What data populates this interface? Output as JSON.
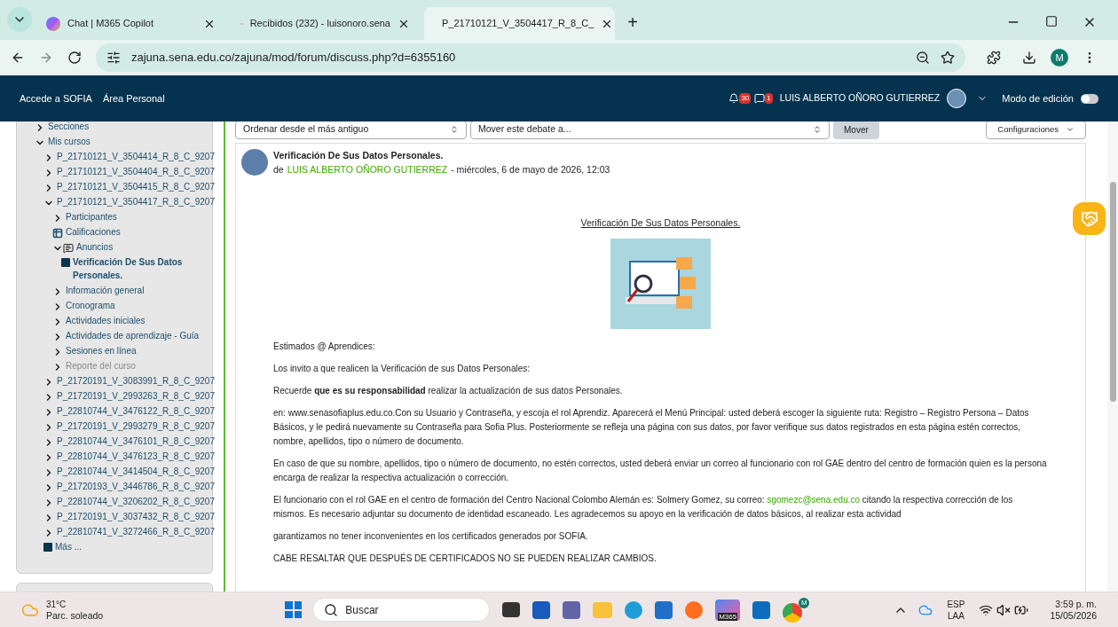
{
  "browser": {
    "tabs": [
      {
        "title": "Chat | M365 Copilot",
        "kind": "copilot",
        "selected": false
      },
      {
        "title": "Recibidos (232) - luisonoro.sena",
        "kind": "gmail",
        "selected": false
      },
      {
        "title": "P_21710121_V_3504417_R_8_C_",
        "kind": "sena",
        "selected": true
      }
    ],
    "new_tab": "+",
    "url": "zajuna.sena.edu.co/zajuna/mod/forum/discuss.php?d=6355160",
    "profile": "M"
  },
  "navbar": {
    "links": [
      "Accede a SOFIA",
      "Área Personal"
    ],
    "notifications": "30",
    "messages": "1",
    "user": "LUIS ALBERTO OÑORO GUTIERREZ",
    "edit_mode": {
      "label": "Modo de edición",
      "on": false
    }
  },
  "sidebar": {
    "items": [
      {
        "label": "Secciones",
        "kind": "node",
        "expanded": false
      },
      {
        "label": "Mis cursos",
        "kind": "node",
        "expanded": true,
        "children": [
          {
            "label": "P_21710121_V_3504414_R_8_C_9207",
            "kind": "node",
            "expanded": false
          },
          {
            "label": "P_21710121_V_3504404_R_8_C_9207",
            "kind": "node",
            "expanded": false
          },
          {
            "label": "P_21710121_V_3504415_R_8_C_9207",
            "kind": "node",
            "expanded": false
          },
          {
            "label": "P_21710121_V_3504417_R_8_C_9207",
            "kind": "node",
            "expanded": true,
            "children": [
              {
                "label": "Participantes",
                "kind": "node",
                "expanded": false
              },
              {
                "label": "Calificaciones",
                "kind": "grades"
              },
              {
                "label": "Anuncios",
                "kind": "forum",
                "expanded": true,
                "children": [
                  {
                    "label": "Verificación De Sus Datos Personales.",
                    "kind": "page",
                    "selected": true
                  }
                ]
              },
              {
                "label": "Información general",
                "kind": "node",
                "expanded": false
              },
              {
                "label": "Cronograma",
                "kind": "node",
                "expanded": false
              },
              {
                "label": "Actividades iniciales",
                "kind": "node",
                "expanded": false
              },
              {
                "label": "Actividades de aprendizaje - Guía",
                "kind": "node",
                "expanded": false
              },
              {
                "label": "Sesiones en línea",
                "kind": "node",
                "expanded": false
              },
              {
                "label": "Reporte del curso",
                "kind": "node",
                "expanded": false,
                "disabled": true
              }
            ]
          },
          {
            "label": "P_21720191_V_3083991_R_8_C_9207",
            "kind": "node",
            "expanded": false
          },
          {
            "label": "P_21720191_V_2993263_R_8_C_9207",
            "kind": "node",
            "expanded": false
          },
          {
            "label": "P_22810744_V_3476122_R_8_C_9207",
            "kind": "node",
            "expanded": false
          },
          {
            "label": "P_21720191_V_2993279_R_8_C_9207",
            "kind": "node",
            "expanded": false
          },
          {
            "label": "P_22810744_V_3476101_R_8_C_9207",
            "kind": "node",
            "expanded": false
          },
          {
            "label": "P_22810744_V_3476123_R_8_C_9207",
            "kind": "node",
            "expanded": false
          },
          {
            "label": "P_22810744_V_3414504_R_8_C_9207",
            "kind": "node",
            "expanded": false
          },
          {
            "label": "P_21720193_V_3446786_R_8_C_9207",
            "kind": "node",
            "expanded": false
          },
          {
            "label": "P_22810744_V_3206202_R_8_C_9207",
            "kind": "node",
            "expanded": false
          },
          {
            "label": "P_21720191_V_3037432_R_8_C_9207",
            "kind": "node",
            "expanded": false
          },
          {
            "label": "P_22810741_V_3272466_R_8_C_9207",
            "kind": "node",
            "expanded": false
          },
          {
            "label": "Más ...",
            "kind": "page",
            "selected": false
          }
        ]
      }
    ]
  },
  "toolbar": {
    "sort": "Ordenar desde el más antiguo",
    "move": "Mover este debate a...",
    "move_button": "Mover",
    "settings": "Configuraciones"
  },
  "post": {
    "subject": "Verificación De Sus Datos Personales.",
    "by": "de",
    "author": "LUIS ALBERTO OÑORO GUTIERREZ",
    "date": "- miércoles, 6 de mayo de 2026, 12:03",
    "heading": "Verificación De Sus Datos Personales.",
    "paragraphs": [
      {
        "text": "Estimados @ Aprendices:"
      },
      {
        "text": "Los invito a que realicen la Verificación de sus Datos Personales:"
      },
      {
        "text": "Recuerde **que es su responsabilidad** realizar la actualización de sus datos Personales."
      },
      {
        "text": "en: www.senasofiaplus.edu.co.Con su Usuario y Contraseña, y escoja el rol Aprendiz. Aparecerá el Menú Principal: usted deberá escoger la siguiente ruta: Registro – Registro Persona – Datos Básicos, y le pedirá nuevamente su Contraseña para Sofia Plus. Posteriormente se refleja una página con sus datos, por favor verifique sus datos registrados en esta página estén correctos, nombre, apellidos, tipo o número de documento."
      },
      {
        "text": "En caso de que su nombre, apellidos, tipo o número de documento, no estén correctos, usted deberá enviar un correo al funcionario con rol GAE dentro del centro de formación quien es la persona encarga de realizar la respectiva actualización o corrección."
      },
      {
        "text": "El funcionario con el rol GAE en el centro de formación del Centro Nacional Colombo Alemán es: Solmery Gomez, su correo: ",
        "link": "sgomezc@sena.edu.co",
        "after": " citando la respectiva corrección de los mismos. Es necesario adjuntar su documento de identidad escaneado. Les agradecemos su apoyo en la verificación de datos básicos, al realizar esta actividad"
      },
      {
        "text": "garantizamos no tener inconvenientes en los certificados generados por SOFIA."
      },
      {
        "text": "CABE RESALTAR QUE DESPUÉS DE CERTIFICADOS NO SE PUEDEN REALIZAR CAMBIOS."
      }
    ]
  },
  "taskbar": {
    "weather": {
      "temp": "31°C",
      "desc": "Parc. soleado"
    },
    "search": "Buscar",
    "copilot_badge": "M365",
    "chrome_badge": "M",
    "lang": "ESP",
    "layout": "LAA",
    "time": "3:59 p. m.",
    "date": "15/05/2026"
  }
}
